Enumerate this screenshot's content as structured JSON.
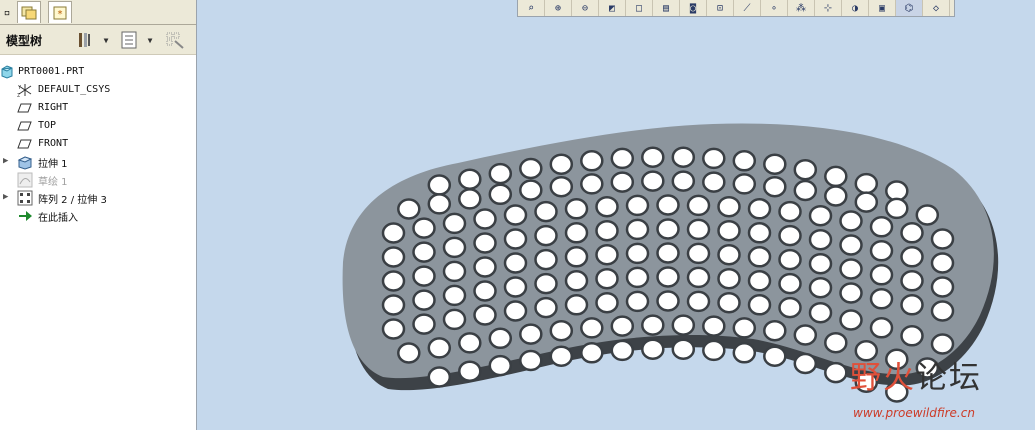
{
  "panel": {
    "tabs": [
      {
        "name": "model-tree-tab-icon"
      },
      {
        "name": "folder-browser-tab-icon"
      }
    ],
    "header": {
      "title": "模型树",
      "icons": [
        "tools-icon",
        "chevron-down-icon",
        "list-settings-icon",
        "chevron-down-icon",
        "filter-icon"
      ]
    },
    "tree": [
      {
        "label": "PRT0001.PRT",
        "icon": "part-icon",
        "expandable": false,
        "dim": false
      },
      {
        "label": "DEFAULT_CSYS",
        "icon": "csys-icon",
        "expandable": false,
        "dim": false
      },
      {
        "label": "RIGHT",
        "icon": "datum-plane-icon",
        "expandable": false,
        "dim": false
      },
      {
        "label": "TOP",
        "icon": "datum-plane-icon",
        "expandable": false,
        "dim": false
      },
      {
        "label": "FRONT",
        "icon": "datum-plane-icon",
        "expandable": false,
        "dim": false
      },
      {
        "label": "拉伸 1",
        "icon": "extrude-icon",
        "expandable": true,
        "dim": false
      },
      {
        "label": "草绘 1",
        "icon": "sketch-icon",
        "expandable": false,
        "dim": true
      },
      {
        "label": "阵列 2 / 拉伸 3",
        "icon": "pattern-icon",
        "expandable": true,
        "dim": false
      },
      {
        "label": "在此插入",
        "icon": "insert-arrow-icon",
        "expandable": false,
        "dim": false
      }
    ]
  },
  "toolbar": {
    "buttons": [
      "zoom-fit-icon",
      "zoom-in-icon",
      "zoom-out-icon",
      "repaint-icon",
      "saved-views-icon",
      "view-manager-icon",
      "camera-icon",
      "plane-display-icon",
      "axis-display-icon",
      "point-display-icon",
      "csys-display-icon",
      "annotation-display-icon",
      "spin-center-icon",
      "perspective-icon",
      "orient-icon",
      "hidden-line-icon"
    ]
  },
  "model": {
    "color": "#8c959d",
    "hole_color": "#ffffff",
    "hole_rows": [
      16,
      18,
      19,
      19,
      19,
      19,
      19,
      18,
      16
    ]
  },
  "watermark": {
    "cn": "野火论坛",
    "url": "www.proewildfire.cn"
  }
}
